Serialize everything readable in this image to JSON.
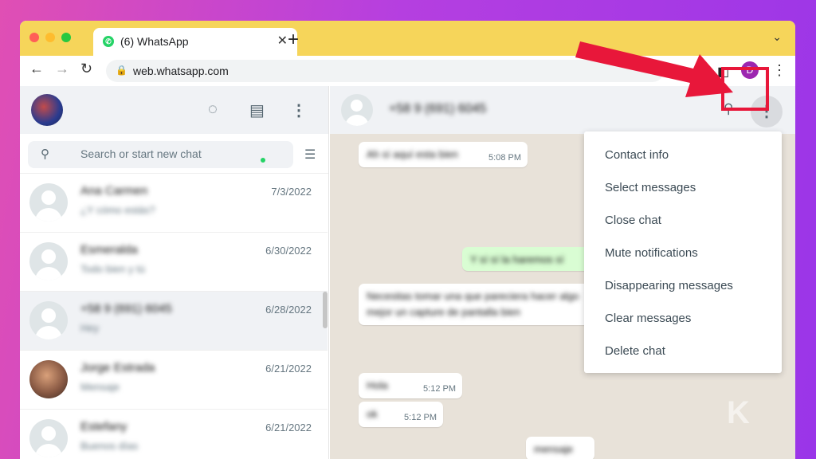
{
  "browser": {
    "tab_title": "(6) WhatsApp",
    "favicon_glyph": "✆",
    "url": "web.whatsapp.com",
    "profile_initial": "D",
    "colors": {
      "tabstrip": "#f6d55a",
      "profile": "#9c27b0"
    }
  },
  "sidebar": {
    "search_placeholder": "Search or start new chat",
    "chats": [
      {
        "name": "Ana Carmen",
        "preview": "¿Y cómo estás?",
        "date": "7/3/2022",
        "avatar": "default"
      },
      {
        "name": "Esmeralda",
        "preview": "Todo bien y tú",
        "date": "6/30/2022",
        "avatar": "default"
      },
      {
        "name": "+58 9 (691) 6045",
        "preview": "Hey",
        "date": "6/28/2022",
        "avatar": "default",
        "active": true
      },
      {
        "name": "Jorge Estrada",
        "preview": "Mensaje",
        "date": "6/21/2022",
        "avatar": "photo"
      },
      {
        "name": "Estefany",
        "preview": "Buenos días",
        "date": "6/21/2022",
        "avatar": "default"
      }
    ]
  },
  "conversation": {
    "contact_name": "+58 9 (691) 6045",
    "messages": [
      {
        "text": "Ah sí aquí esta bien",
        "time": "5:08 PM",
        "dir": "in"
      },
      {
        "text": "Y sí sí la haremos sí",
        "time": "",
        "dir": "out"
      },
      {
        "text": "Necesitas tomar una que pareciera hacer algo",
        "text2": "mejor un capture de pantalla bien",
        "time": "",
        "dir": "in"
      },
      {
        "text": "Hola",
        "time": "5:12 PM",
        "dir": "in"
      },
      {
        "text": "ok",
        "time": "5:12 PM",
        "dir": "in"
      },
      {
        "text": "mensaje",
        "time": "",
        "dir": "in"
      }
    ]
  },
  "menu": {
    "items": [
      "Contact info",
      "Select messages",
      "Close chat",
      "Mute notifications",
      "Disappearing messages",
      "Clear messages",
      "Delete chat"
    ]
  },
  "annotation": {
    "color": "#e8173a"
  },
  "watermark": "K"
}
